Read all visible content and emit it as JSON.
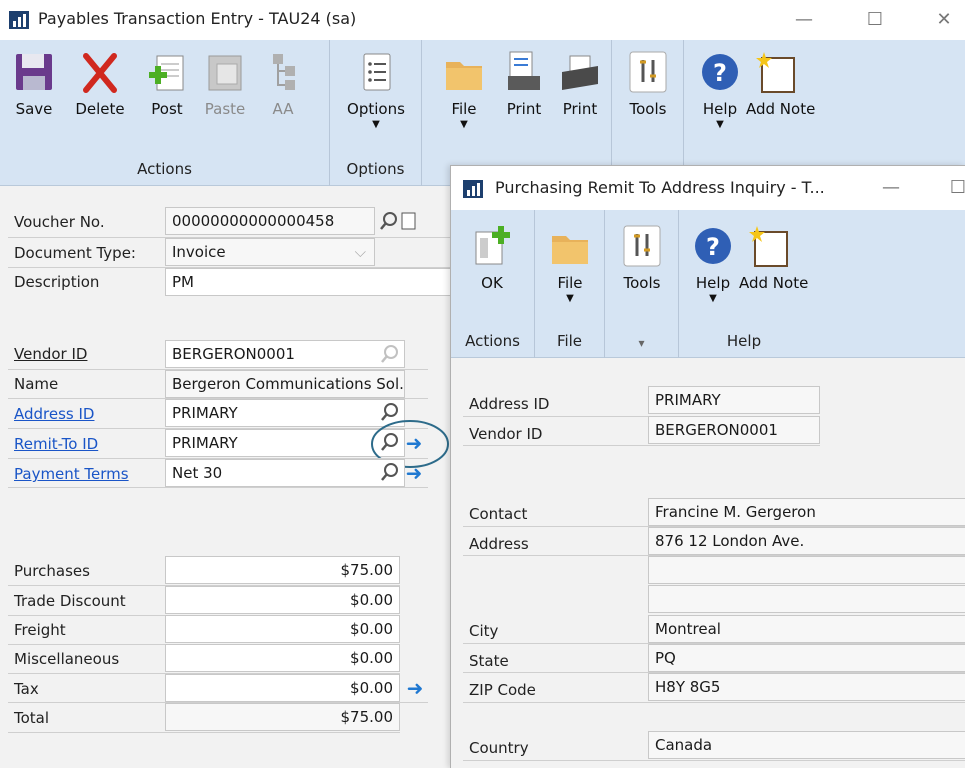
{
  "main": {
    "title": "Payables Transaction Entry  -  TAU24 (sa)",
    "ribbon": {
      "save": "Save",
      "delete": "Delete",
      "post": "Post",
      "paste": "Paste",
      "aa": "AA",
      "options": "Options",
      "file": "File",
      "print1": "Print",
      "print2": "Print",
      "tools": "Tools",
      "help": "Help",
      "add_note": "Add Note",
      "group_actions": "Actions",
      "group_options": "Options"
    },
    "form": {
      "voucher_label": "Voucher No.",
      "voucher_value": "00000000000000458",
      "doctype_label": "Document Type:",
      "doctype_value": "Invoice",
      "description_label": "Description",
      "description_value": "PM",
      "vendor_label": "Vendor ID",
      "vendor_value": "BERGERON0001",
      "name_label": "Name",
      "name_value": "Bergeron Communications Sol.",
      "address_label": "Address ID",
      "address_value": "PRIMARY",
      "remit_label": "Remit-To ID",
      "remit_value": "PRIMARY",
      "terms_label": "Payment Terms",
      "terms_value": "Net 30"
    },
    "totals": [
      {
        "label": "Purchases",
        "value": "$75.00"
      },
      {
        "label": "Trade Discount",
        "value": "$0.00"
      },
      {
        "label": "Freight",
        "value": "$0.00"
      },
      {
        "label": "Miscellaneous",
        "value": "$0.00"
      },
      {
        "label": "Tax",
        "value": "$0.00"
      },
      {
        "label": "Total",
        "value": "$75.00"
      }
    ]
  },
  "child": {
    "title": "Purchasing Remit To Address Inquiry  -  T...",
    "ribbon": {
      "ok": "OK",
      "file": "File",
      "tools": "Tools",
      "help": "Help",
      "add_note": "Add Note",
      "group_actions": "Actions",
      "group_file": "File",
      "group_help": "Help"
    },
    "fields": {
      "address_label": "Address ID",
      "address_value": "PRIMARY",
      "vendor_label": "Vendor ID",
      "vendor_value": "BERGERON0001",
      "contact_label": "Contact",
      "contact_value": "Francine M. Gergeron",
      "address2_label": "Address",
      "address2_value": "876 12 London Ave.",
      "city_label": "City",
      "city_value": "Montreal",
      "state_label": "State",
      "state_value": "PQ",
      "zip_label": "ZIP Code",
      "zip_value": "H8Y 8G5",
      "country_label": "Country",
      "country_value": "Canada"
    }
  },
  "colors": {
    "ribbon": "#d6e4f3",
    "link": "#1a55c7",
    "arrow": "#1f78d1",
    "highlight_circle": "#2d6b8a"
  },
  "icons": [
    "app-logo-icon",
    "save-icon",
    "delete-icon",
    "post-icon",
    "paste-icon",
    "aa-icon",
    "options-icon",
    "file-folder-icon",
    "print-icon",
    "printer-icon",
    "tools-icon",
    "help-icon",
    "add-note-icon",
    "lookup-icon",
    "expand-arrow-icon"
  ]
}
